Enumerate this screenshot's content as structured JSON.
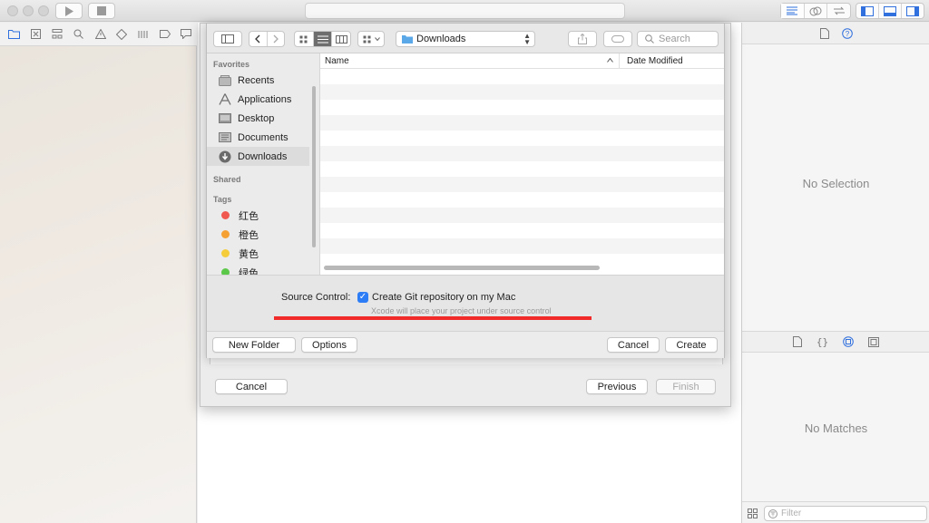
{
  "window": {
    "toolbar": {
      "run_icon": "play-icon",
      "stop_icon": "stop-icon",
      "editor_modes": [
        "standard-editor-icon",
        "assistant-editor-icon",
        "version-editor-icon"
      ],
      "panel_toggles": [
        "navigator-toggle-icon",
        "debug-area-toggle-icon",
        "utilities-toggle-icon"
      ]
    },
    "navigator_tabs": [
      "folder-icon",
      "source-control-icon",
      "hierarchy-icon",
      "search-icon",
      "warning-icon",
      "test-icon",
      "debug-icon",
      "breakpoint-icon",
      "report-icon"
    ]
  },
  "inspector": {
    "top_message": "No Selection",
    "library_message": "No Matches",
    "filter_placeholder": "Filter"
  },
  "assistant_sheet": {
    "cancel": "Cancel",
    "previous": "Previous",
    "finish": "Finish"
  },
  "save_panel": {
    "location": "Downloads",
    "search_placeholder": "Search",
    "sidebar": {
      "favorites_heading": "Favorites",
      "favorites": [
        {
          "label": "Recents",
          "icon": "recents-icon"
        },
        {
          "label": "Applications",
          "icon": "applications-icon"
        },
        {
          "label": "Desktop",
          "icon": "desktop-icon"
        },
        {
          "label": "Documents",
          "icon": "documents-icon"
        },
        {
          "label": "Downloads",
          "icon": "downloads-icon",
          "selected": true
        }
      ],
      "shared_heading": "Shared",
      "tags_heading": "Tags",
      "tags": [
        {
          "label": "红色",
          "color": "#f0584f"
        },
        {
          "label": "橙色",
          "color": "#f5a033"
        },
        {
          "label": "黄色",
          "color": "#f5cd3a"
        },
        {
          "label": "绿色",
          "color": "#5cc84a"
        }
      ]
    },
    "columns": {
      "name": "Name",
      "date_modified": "Date Modified"
    },
    "source_control": {
      "label": "Source Control:",
      "checkbox_label": "Create Git repository on my Mac",
      "checked": true,
      "hint": "Xcode will place your project under source control",
      "highlight_color": "#f12a2a"
    },
    "buttons": {
      "new_folder": "New Folder",
      "options": "Options",
      "cancel": "Cancel",
      "create": "Create"
    }
  }
}
